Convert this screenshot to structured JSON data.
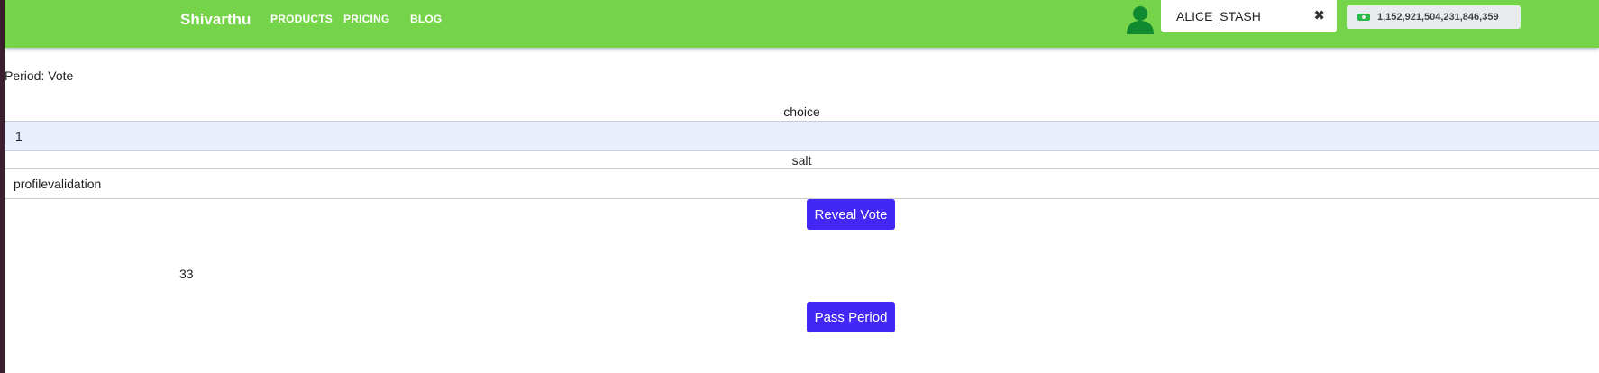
{
  "navbar": {
    "brand": "Shivarthu",
    "links": [
      "PRODUCTS",
      "PRICING",
      "BLOG"
    ],
    "background": "#76d44a"
  },
  "account": {
    "name": "ALICE_STASH",
    "close_icon": "close-icon",
    "balance": "1,152,921,504,231,846,359"
  },
  "period": {
    "label": "Period: Vote"
  },
  "vote_form": {
    "choice_label": "choice",
    "choice_value": "1",
    "salt_label": "salt",
    "salt_value": "profilevalidation",
    "reveal_button": "Reveal Vote"
  },
  "counter": {
    "value": "33"
  },
  "pass_period_button": "Pass Period",
  "colors": {
    "accent": "#4328f5",
    "choice_row_bg": "#e8eefc"
  }
}
